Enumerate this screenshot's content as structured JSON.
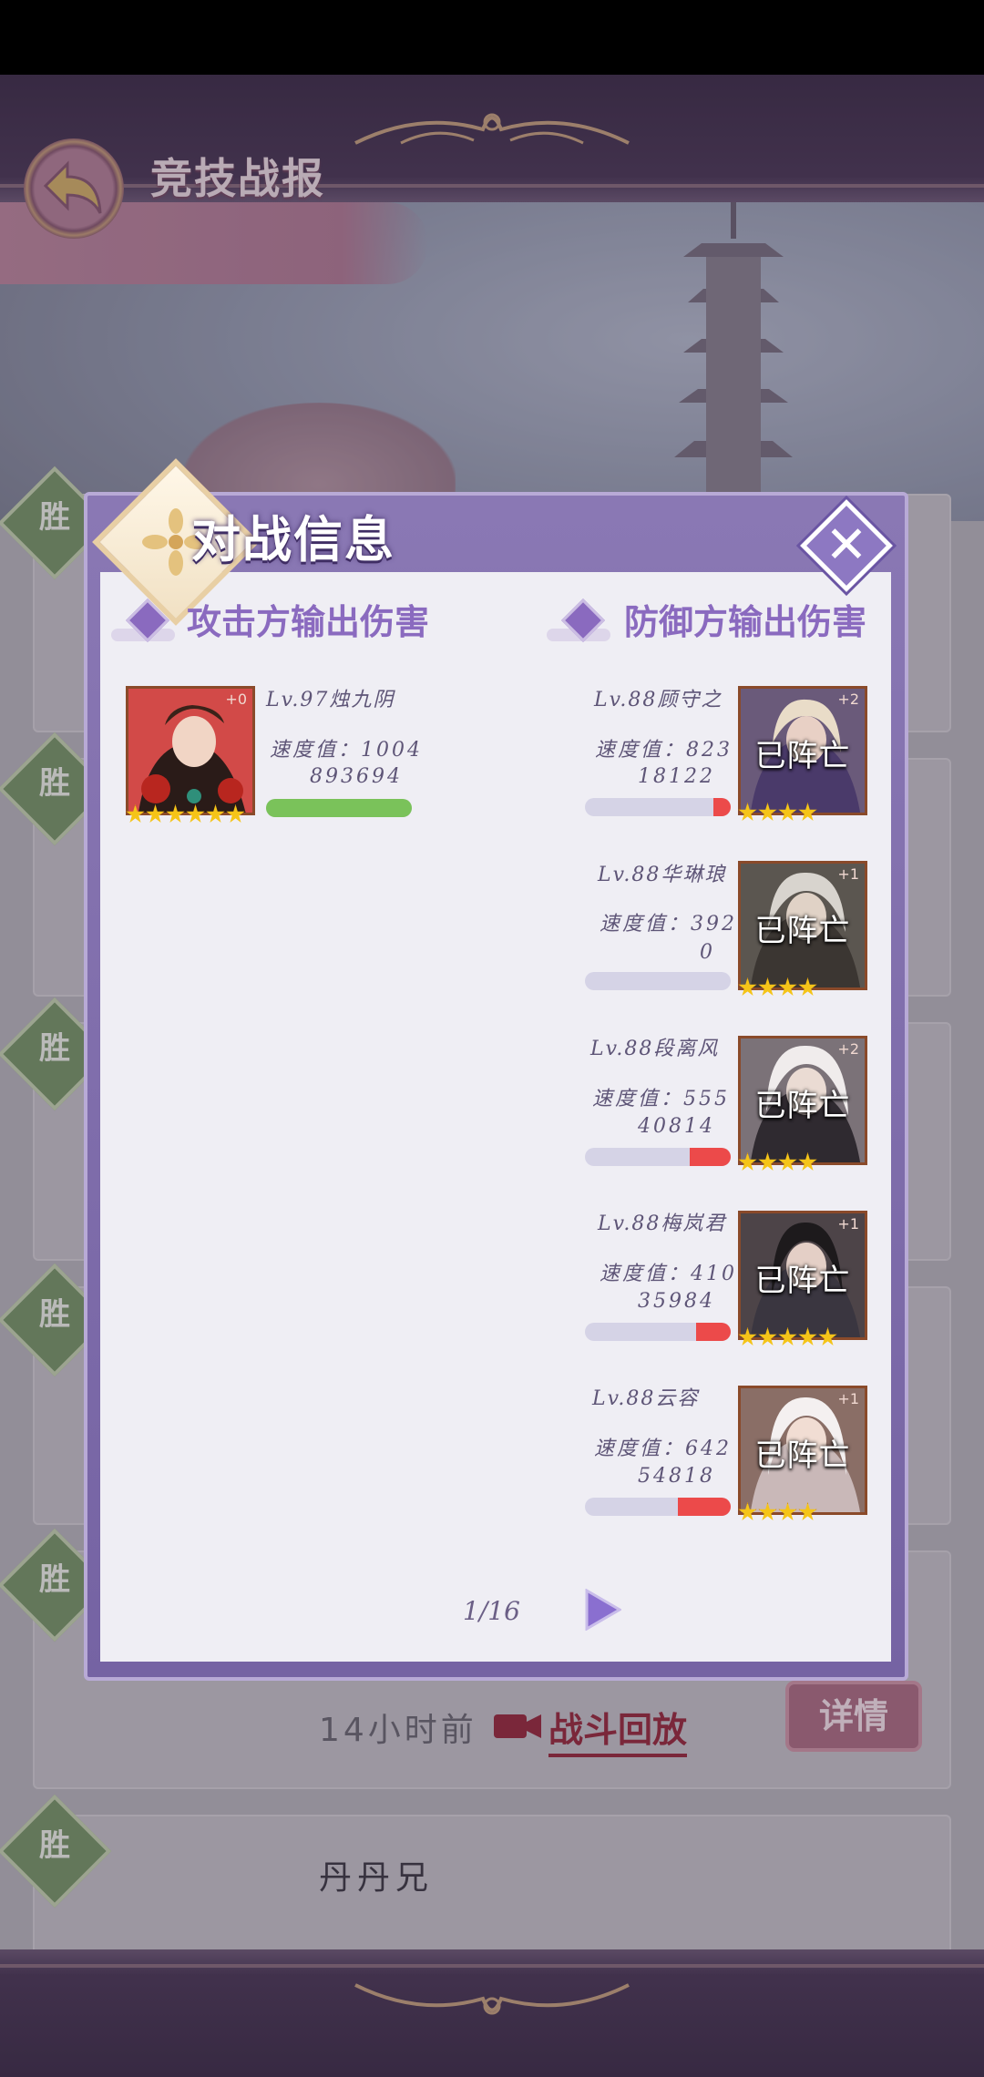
{
  "page": {
    "title": "竞技战报"
  },
  "list": {
    "win_label": "胜",
    "time_text": "14小时前",
    "replay_label": "战斗回放",
    "detail_label": "详情",
    "last_player_name": "丹丹兄"
  },
  "modal": {
    "title": "对战信息",
    "attacker_heading": "攻击方输出伤害",
    "defender_heading": "防御方输出伤害",
    "pager": "1/16",
    "attacker": [
      {
        "name": "Lv.97烛九阴",
        "speed": "速度值：1004",
        "damage": "893694",
        "plus": "+0",
        "stars": 6,
        "bar_fill": 1.0,
        "bar_color": "#7ac25a"
      }
    ],
    "defenders": [
      {
        "name": "Lv.88顾守之",
        "speed": "速度值：823",
        "damage": "18122",
        "deployed": "已阵亡",
        "plus": "+2",
        "stars": 4,
        "bar_fill": 0.12,
        "bar_color": "#ec4a4a"
      },
      {
        "name": "Lv.88华琳琅",
        "speed": "速度值：392",
        "damage": "0",
        "deployed": "已阵亡",
        "plus": "+1",
        "stars": 4,
        "bar_fill": 0.0,
        "bar_color": "#ec4a4a"
      },
      {
        "name": "Lv.88段离风",
        "speed": "速度值：555",
        "damage": "40814",
        "deployed": "已阵亡",
        "plus": "+2",
        "stars": 4,
        "bar_fill": 0.28,
        "bar_color": "#ec4a4a"
      },
      {
        "name": "Lv.88梅岚君",
        "speed": "速度值：410",
        "damage": "35984",
        "deployed": "已阵亡",
        "plus": "+1",
        "stars": 5,
        "bar_fill": 0.24,
        "bar_color": "#ec4a4a"
      },
      {
        "name": "Lv.88云容",
        "speed": "速度值：642",
        "damage": "54818",
        "deployed": "已阵亡",
        "plus": "+1",
        "stars": 4,
        "bar_fill": 0.36,
        "bar_color": "#ec4a4a"
      }
    ]
  },
  "icons": {
    "back": "back-arrow-icon",
    "close": "close-icon",
    "next": "play-triangle-icon",
    "replay": "video-camera-icon"
  }
}
